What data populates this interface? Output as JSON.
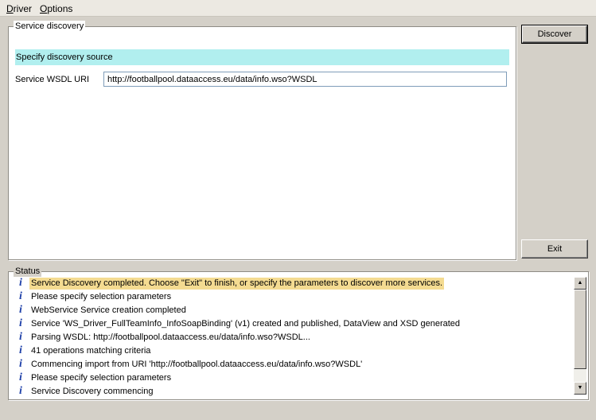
{
  "menu": {
    "items": [
      {
        "label": "Driver",
        "mnemonic": "D",
        "rest": "river"
      },
      {
        "label": "Options",
        "mnemonic": "O",
        "rest": "ptions"
      }
    ]
  },
  "discovery": {
    "group_title": "Service discovery",
    "banner": "Specify discovery source",
    "wsdl_label": "Service WSDL URI",
    "wsdl_value": "http://footballpool.dataaccess.eu/data/info.wso?WSDL"
  },
  "buttons": {
    "discover": "Discover",
    "exit": "Exit"
  },
  "status": {
    "group_title": "Status",
    "icon": "info-icon",
    "entries": [
      "Service Discovery completed. Choose \"Exit\" to finish, or specify the parameters to discover more services.",
      "Please specify selection parameters",
      "WebService Service creation completed",
      "Service 'WS_Driver_FullTeamInfo_InfoSoapBinding' (v1) created and published, DataView and XSD generated",
      "Parsing WSDL: http://footballpool.dataaccess.eu/data/info.wso?WSDL...",
      "41 operations matching criteria",
      "Commencing import from URI 'http://footballpool.dataaccess.eu/data/info.wso?WSDL'",
      "Please specify selection parameters",
      "Service Discovery commencing"
    ],
    "highlight_color": "#f4db91"
  },
  "colors": {
    "banner": "#b1efef",
    "window": "#d4d0c8"
  }
}
